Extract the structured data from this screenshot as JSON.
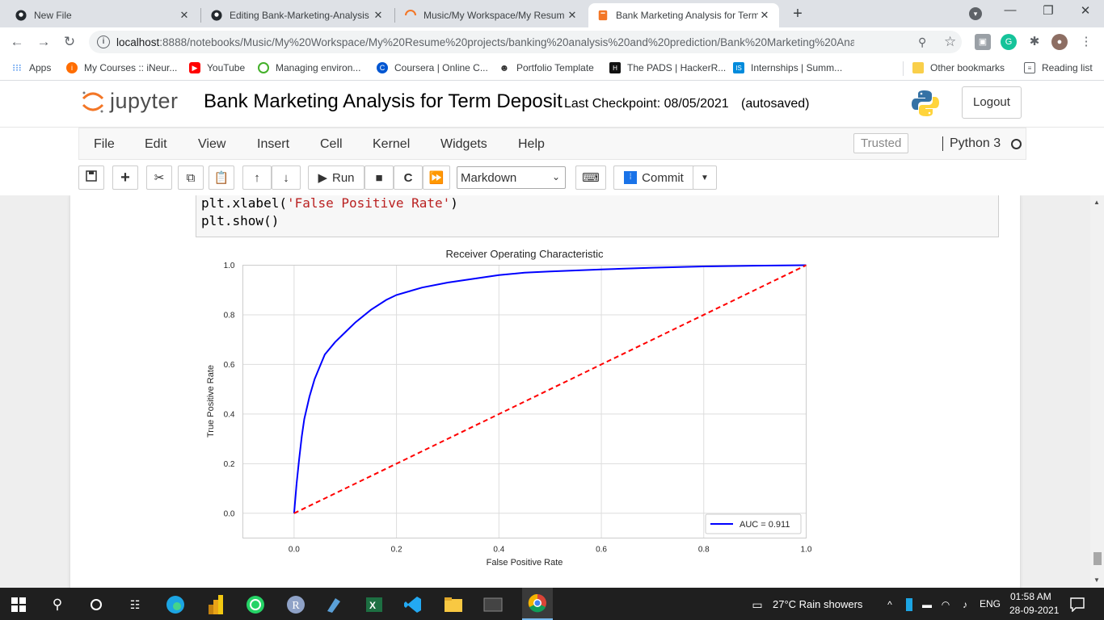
{
  "browser": {
    "tabs": [
      {
        "title": "New File",
        "active": false
      },
      {
        "title": "Editing Bank-Marketing-Analysis",
        "active": false
      },
      {
        "title": "Music/My Workspace/My Resum",
        "active": false
      },
      {
        "title": "Bank Marketing Analysis for Term",
        "active": true
      }
    ],
    "close_glyph": "✕",
    "new_tab_glyph": "+",
    "url_host": "localhost",
    "url_path": ":8888/notebooks/Music/My%20Workspace/My%20Resume%20projects/banking%20analysis%20and%20prediction/Bank%20Marketing%20Analysis...",
    "bookmarks": [
      {
        "label": "Apps",
        "icon": "apps-grid-icon"
      },
      {
        "label": "My Courses :: iNeur...",
        "icon": "ineuron-icon"
      },
      {
        "label": "YouTube",
        "icon": "youtube-icon"
      },
      {
        "label": "Managing environ...",
        "icon": "conda-icon"
      },
      {
        "label": "Coursera | Online C...",
        "icon": "coursera-icon"
      },
      {
        "label": "Portfolio Template",
        "icon": "portfolio-icon"
      },
      {
        "label": "The PADS | HackerR...",
        "icon": "hackerrank-icon"
      },
      {
        "label": "Internships | Summ...",
        "icon": "internshala-icon"
      },
      {
        "label": "Other bookmarks",
        "icon": "folder-icon"
      },
      {
        "label": "Reading list",
        "icon": "reading-list-icon"
      }
    ]
  },
  "jupyter": {
    "brand": "jupyter",
    "notebook_title": "Bank Marketing Analysis for Term Deposit",
    "checkpoint": "Last Checkpoint: 08/05/2021",
    "autosave": "(autosaved)",
    "logout": "Logout",
    "menu": [
      "File",
      "Edit",
      "View",
      "Insert",
      "Cell",
      "Kernel",
      "Widgets",
      "Help"
    ],
    "trusted": "Trusted",
    "kernel": "Python 3",
    "toolbar": {
      "run": "Run",
      "cell_type": "Markdown",
      "commit": "Commit"
    },
    "code": {
      "line1_prefix": "plt.xlabel(",
      "line1_string": "'False Positive Rate'",
      "line1_suffix": ")",
      "line2": "plt.show()"
    }
  },
  "chart_data": {
    "type": "line",
    "title": "Receiver Operating Characteristic",
    "xlabel": "False Positive Rate",
    "ylabel": "True Positive Rate",
    "xlim": [
      -0.1,
      1.0
    ],
    "ylim": [
      -0.1,
      1.0
    ],
    "xticks": [
      "0.0",
      "0.2",
      "0.4",
      "0.6",
      "0.8",
      "1.0"
    ],
    "yticks": [
      "0.0",
      "0.2",
      "0.4",
      "0.6",
      "0.8",
      "1.0"
    ],
    "grid": true,
    "legend_position": "lower-right",
    "series": [
      {
        "name": "AUC = 0.911",
        "color": "#0000ff",
        "style": "solid",
        "x": [
          0.0,
          0.005,
          0.01,
          0.015,
          0.02,
          0.03,
          0.04,
          0.05,
          0.06,
          0.08,
          0.1,
          0.12,
          0.15,
          0.18,
          0.2,
          0.25,
          0.3,
          0.35,
          0.4,
          0.45,
          0.5,
          0.6,
          0.7,
          0.8,
          0.9,
          1.0
        ],
        "y": [
          0.0,
          0.12,
          0.22,
          0.31,
          0.38,
          0.47,
          0.54,
          0.59,
          0.64,
          0.69,
          0.73,
          0.77,
          0.82,
          0.86,
          0.88,
          0.91,
          0.93,
          0.945,
          0.96,
          0.97,
          0.975,
          0.983,
          0.99,
          0.995,
          0.998,
          1.0
        ]
      },
      {
        "name": "",
        "color": "#ff0000",
        "style": "dashed",
        "x": [
          0.0,
          1.0
        ],
        "y": [
          0.0,
          1.0
        ]
      }
    ]
  },
  "taskbar": {
    "weather": "27°C  Rain showers",
    "language": "ENG",
    "time": "01:58 AM",
    "date": "28-09-2021"
  }
}
